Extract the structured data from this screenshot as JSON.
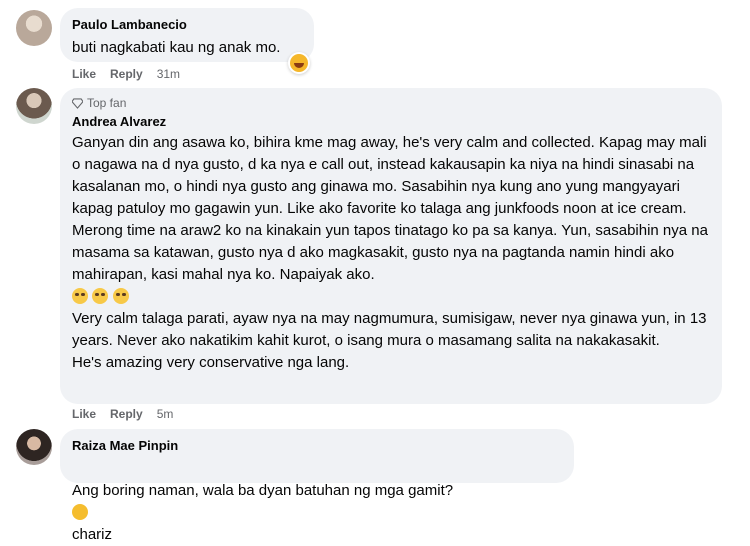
{
  "comments": [
    {
      "name": "Paulo Lambanecio",
      "text": "buti nagkabati kau ng anak mo.",
      "like": "Like",
      "reply": "Reply",
      "time": "31m",
      "reaction_icon": "grinning-emoji-icon"
    },
    {
      "badge": "Top fan",
      "name": "Andrea Alvarez",
      "text": "Ganyan din ang asawa ko, bihira kme mag away, he's very calm and collected. Kapag may mali o nagawa na d nya gusto, d ka nya e call out, instead kakausapin ka niya na hindi sinasabi na kasalanan mo, o hindi nya gusto ang ginawa mo. Sasabihin nya kung ano yung mangyayari kapag patuloy mo gagawin yun. Like ako favorite ko talaga ang junkfoods noon at ice cream. Merong time na araw2 ko na kinakain yun tapos tinatago ko pa sa kanya. Yun, sasabihin nya na masama sa katawan, gusto nya d ako magkasakit, gusto nya na pagtanda namin hindi ako mahirapan, kasi mahal nya ko. Napaiyak ako.",
      "text2": "Very calm talaga parati, ayaw nya na may nagmumura, sumisigaw, never nya ginawa yun, in 13 years. Never ako nakatikim kahit kurot, o isang mura o masamang salita na nakakasakit.\nHe's amazing very conservative nga lang.",
      "like": "Like",
      "reply": "Reply",
      "time": "5m"
    },
    {
      "name": "Raiza Mae Pinpin",
      "text": "Ang boring naman, wala ba dyan batuhan ng mga gamit?",
      "suffix": "chariz",
      "emoji_icon": "laughing-emoji-icon"
    }
  ]
}
